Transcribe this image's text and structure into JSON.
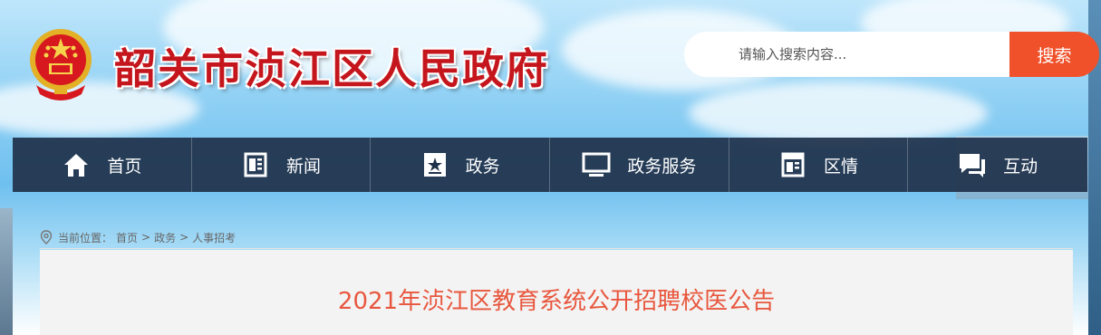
{
  "header": {
    "site_title": "韶关市浈江区人民政府",
    "emblem": "national-emblem",
    "search": {
      "placeholder": "请输入搜索内容...",
      "button_label": "搜索"
    }
  },
  "nav": {
    "items": [
      {
        "label": "首页",
        "icon": "home-icon"
      },
      {
        "label": "新闻",
        "icon": "newspaper-icon"
      },
      {
        "label": "政务",
        "icon": "star-badge-icon"
      },
      {
        "label": "政务服务",
        "icon": "monitor-icon"
      },
      {
        "label": "区情",
        "icon": "document-icon"
      },
      {
        "label": "互动",
        "icon": "chat-icon"
      }
    ]
  },
  "breadcrumb": {
    "prefix": "当前位置：",
    "items": [
      "首页",
      "政务",
      "人事招考"
    ],
    "separator": ">"
  },
  "article": {
    "title": "2021年浈江区教育系统公开招聘校医公告"
  },
  "colors": {
    "title_red": "#c4161c",
    "search_orange": "#f0512a",
    "nav_bg": "#1f314a",
    "article_title": "#e8573e"
  }
}
